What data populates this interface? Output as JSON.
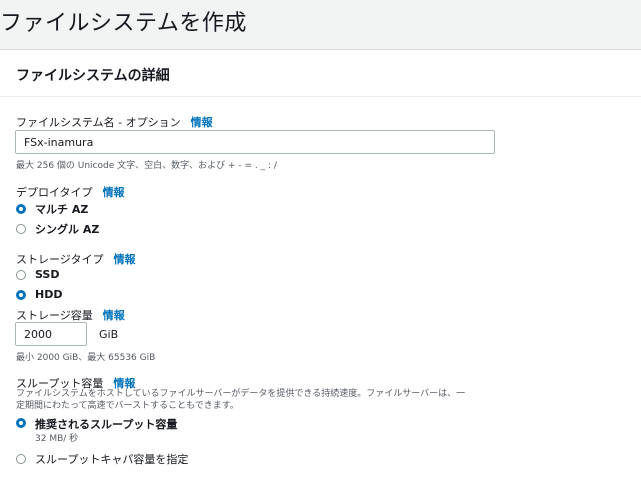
{
  "page": {
    "title": "ファイルシステムを作成"
  },
  "panel": {
    "header": "ファイルシステムの詳細"
  },
  "filesystem_name": {
    "label": "ファイルシステム名 - オプション",
    "info": "情報",
    "value": "FSx-inamura",
    "hint": "最大 256 個の Unicode 文字、空白、数字、および + - = . _ : /"
  },
  "deploy_type": {
    "label": "デプロイタイプ",
    "info": "情報",
    "options": [
      {
        "label": "マルチ AZ",
        "checked": true
      },
      {
        "label": "シングル AZ",
        "checked": false
      }
    ]
  },
  "storage_type": {
    "label": "ストレージタイプ",
    "info": "情報",
    "options": [
      {
        "label": "SSD",
        "checked": false
      },
      {
        "label": "HDD",
        "checked": true
      }
    ]
  },
  "storage_capacity": {
    "label": "ストレージ容量",
    "info": "情報",
    "value": "2000",
    "unit": "GiB",
    "hint": "最小 2000 GiB、最大 65536 GiB"
  },
  "throughput": {
    "label": "スループット容量",
    "info": "情報",
    "description_line1": "ファイルシステムをホストしているファイルサーバーがデータを提供できる持続速度。ファイルサーバーは、一",
    "description_line2": "定期間にわたって高速でバーストすることもできます。",
    "options": [
      {
        "label": "推奨されるスループット容量",
        "sublabel": "32 MB/ 秒",
        "checked": true
      },
      {
        "label": "スループットキャパ容量を指定",
        "checked": false
      }
    ]
  }
}
